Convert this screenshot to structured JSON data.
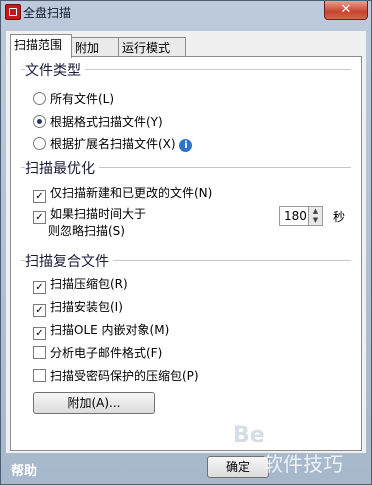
{
  "window": {
    "title": "全盘扫描",
    "close_glyph": "✕"
  },
  "tabs": [
    {
      "label": "扫描范围",
      "active": true
    },
    {
      "label": "附加",
      "active": false
    },
    {
      "label": "运行模式",
      "active": false
    }
  ],
  "file_types": {
    "title": "文件类型",
    "options": [
      {
        "label": "所有文件(L)",
        "selected": false
      },
      {
        "label": "根据格式扫描文件(Y)",
        "selected": true
      },
      {
        "label": "根据扩展名扫描文件(X)",
        "selected": false
      }
    ],
    "info_icon": "info-icon"
  },
  "optimize": {
    "title": "扫描最优化",
    "new_changed_label": "仅扫描新建和已更改的文件(N)",
    "new_changed_checked": true,
    "skip_long_line1": "如果扫描时间大于",
    "skip_long_line2": "则忽略扫描(S)",
    "skip_long_checked": true,
    "seconds_value": "180",
    "seconds_unit": "秒"
  },
  "compound": {
    "title": "扫描复合文件",
    "items": [
      {
        "label": "扫描压缩包(R)",
        "checked": true
      },
      {
        "label": "扫描安装包(I)",
        "checked": true
      },
      {
        "label": "扫描OLE 内嵌对象(M)",
        "checked": true
      },
      {
        "label": "分析电子邮件格式(F)",
        "checked": false
      },
      {
        "label": "扫描受密码保护的压缩包(P)",
        "checked": false
      }
    ],
    "more_button": "附加(A)..."
  },
  "footer": {
    "help": "帮助",
    "ok_button": "确定",
    "watermark": "软件技巧"
  }
}
